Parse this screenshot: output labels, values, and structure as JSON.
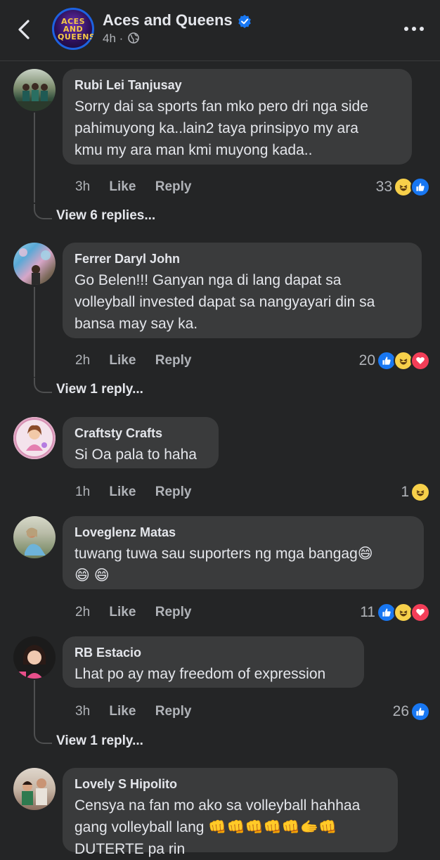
{
  "header": {
    "page_name": "Aces and Queens",
    "logo_text": "ACES AND QUEENS",
    "time": "4h"
  },
  "comments": [
    {
      "author": "Rubi Lei Tanjusay",
      "text_lines": [
        "Sorry dai sa sports fan mko pero dri nga side",
        "pahimuyong ka..lain2 taya prinsipyo my ara",
        "kmu my ara man kmi muyong kada.."
      ],
      "time": "3h",
      "like": "Like",
      "reply": "Reply",
      "reaction_count": "33",
      "view_replies": "View 6 replies..."
    },
    {
      "author": "Ferrer Daryl John",
      "text_lines": [
        "Go Belen!!! Ganyan nga di lang dapat sa",
        "volleyball invested  dapat sa nangyayari din sa",
        "bansa may say ka."
      ],
      "time": "2h",
      "like": "Like",
      "reply": "Reply",
      "reaction_count": "20",
      "view_replies": "View 1 reply..."
    },
    {
      "author": "Craftsty Crafts",
      "text_lines": [
        "Si Oa pala to haha"
      ],
      "time": "1h",
      "like": "Like",
      "reply": "Reply",
      "reaction_count": "1"
    },
    {
      "author": "Loveglenz Matas",
      "text_lines": [
        "tuwang tuwa sau suporters ng mga bangag😄",
        "😄 😄"
      ],
      "time": "2h",
      "like": "Like",
      "reply": "Reply",
      "reaction_count": "11"
    },
    {
      "author": "RB Estacio",
      "text_lines": [
        "Lhat po ay may freedom of expression"
      ],
      "time": "3h",
      "like": "Like",
      "reply": "Reply",
      "reaction_count": "26",
      "view_replies": "View 1 reply..."
    },
    {
      "author": "Lovely S Hipolito",
      "text_lines": [
        "Censya na fan mo ako sa volleyball hahhaa",
        "gang volleyball lang 👊👊👊👊👊🫱👊",
        "DUTERTE pa rin"
      ]
    }
  ],
  "colors": {
    "background": "#242526",
    "bubble": "#3a3b3c",
    "like_blue": "#1877f2",
    "love_red": "#f33e58",
    "haha_yellow": "#f7d04a"
  }
}
